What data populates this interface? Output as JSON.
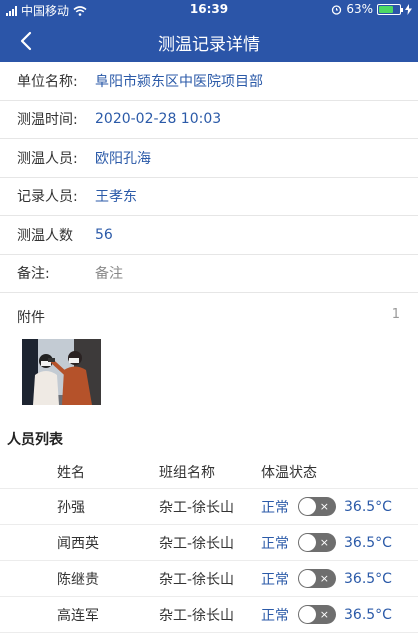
{
  "status_bar": {
    "carrier": "中国移动",
    "time": "16:39",
    "battery": "63%"
  },
  "header": {
    "title": "测温记录详情",
    "back_icon": "chevron-left-icon"
  },
  "form": [
    {
      "label": "单位名称:",
      "value": "阜阳市颍东区中医院项目部"
    },
    {
      "label": "测温时间:",
      "value": "2020-02-28 10:03"
    },
    {
      "label": "测温人员:",
      "value": "欧阳孔海"
    },
    {
      "label": "记录人员:",
      "value": "王孝东"
    },
    {
      "label": "测温人数",
      "value": "56"
    },
    {
      "label": "备注:",
      "value": "备注"
    }
  ],
  "attachments": {
    "title": "附件",
    "count": "1"
  },
  "people": {
    "title": "人员列表",
    "columns": [
      "姓名",
      "班组名称",
      "体温状态"
    ],
    "rows": [
      {
        "name": "孙强",
        "team": "杂工-徐长山",
        "status": "正常",
        "temp": "36.5°C"
      },
      {
        "name": "闻西英",
        "team": "杂工-徐长山",
        "status": "正常",
        "temp": "36.5°C"
      },
      {
        "name": "陈继贵",
        "team": "杂工-徐长山",
        "status": "正常",
        "temp": "36.5°C"
      },
      {
        "name": "高连军",
        "team": "杂工-徐长山",
        "status": "正常",
        "temp": "36.5°C"
      }
    ],
    "toggle_symbol": "×"
  },
  "colors": {
    "header": "#2b55a8",
    "accent": "#2b5aa8",
    "toggle": "#6e6e6e"
  }
}
